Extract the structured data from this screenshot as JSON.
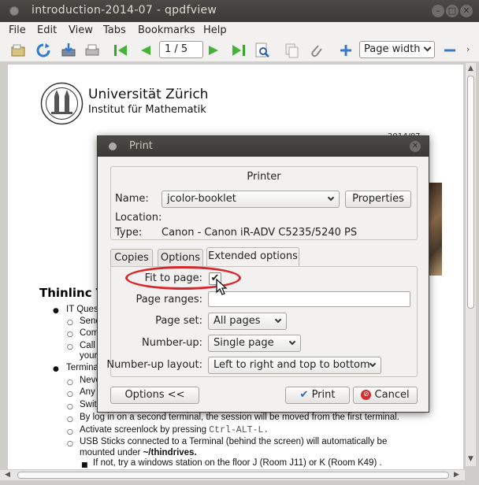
{
  "window": {
    "title": "introduction-2014-07 - qpdfview"
  },
  "menu": [
    "File",
    "Edit",
    "View",
    "Tabs",
    "Bookmarks",
    "Help"
  ],
  "toolbar": {
    "page_value": "1 / 5",
    "zoom_value": "Page width",
    "icons": [
      "open-icon",
      "refresh-icon",
      "save-icon",
      "print-icon",
      "first-page-icon",
      "previous-page-icon",
      "next-page-icon",
      "last-page-icon",
      "search-icon",
      "copy-icon",
      "attachment-icon",
      "zoom-in-icon",
      "zoom-out-icon"
    ]
  },
  "document": {
    "uni_title": "Universität Zürich",
    "uni_subtitle": "Institut für Mathematik",
    "date_fragment": "2014/07",
    "section_heading": "Thinlinc Te",
    "lines": [
      "IT Ques",
      "Send",
      "Com",
      "Call",
      "your",
      "Termina",
      "Neve",
      "Any",
      "Swit",
      "By log in on a second terminal, the session will be moved from the first terminal.",
      "Activate screenlock by pressing",
      "Ctrl-ALT-L.",
      "USB Sticks connected to a Terminal (behind the screen) will automatically be",
      "mounted under",
      "~/thindrives.",
      "If not, try a windows station on the floor J (Room J11) or K (Room K49) ."
    ]
  },
  "dialog": {
    "title": "Print",
    "printer_group_title": "Printer",
    "name_label": "Name:",
    "printer_name": "jcolor-booklet",
    "properties_label": "Properties",
    "location_label": "Location:",
    "location_value": "",
    "type_label": "Type:",
    "type_value": "Canon - Canon iR-ADV C5235/5240 PS",
    "tabs": [
      "Copies",
      "Options",
      "Extended options"
    ],
    "fit_to_page_label": "Fit to page:",
    "fit_to_page_checked": true,
    "page_ranges_label": "Page ranges:",
    "page_ranges_value": "",
    "page_set_label": "Page set:",
    "page_set_value": "All pages",
    "number_up_label": "Number-up:",
    "number_up_value": "Single page",
    "number_up_layout_label": "Number-up layout:",
    "number_up_layout_value": "Left to right and top to bottom",
    "options_button": "Options <<",
    "print_button": "Print",
    "cancel_button": "Cancel",
    "check_mark": "✔"
  }
}
